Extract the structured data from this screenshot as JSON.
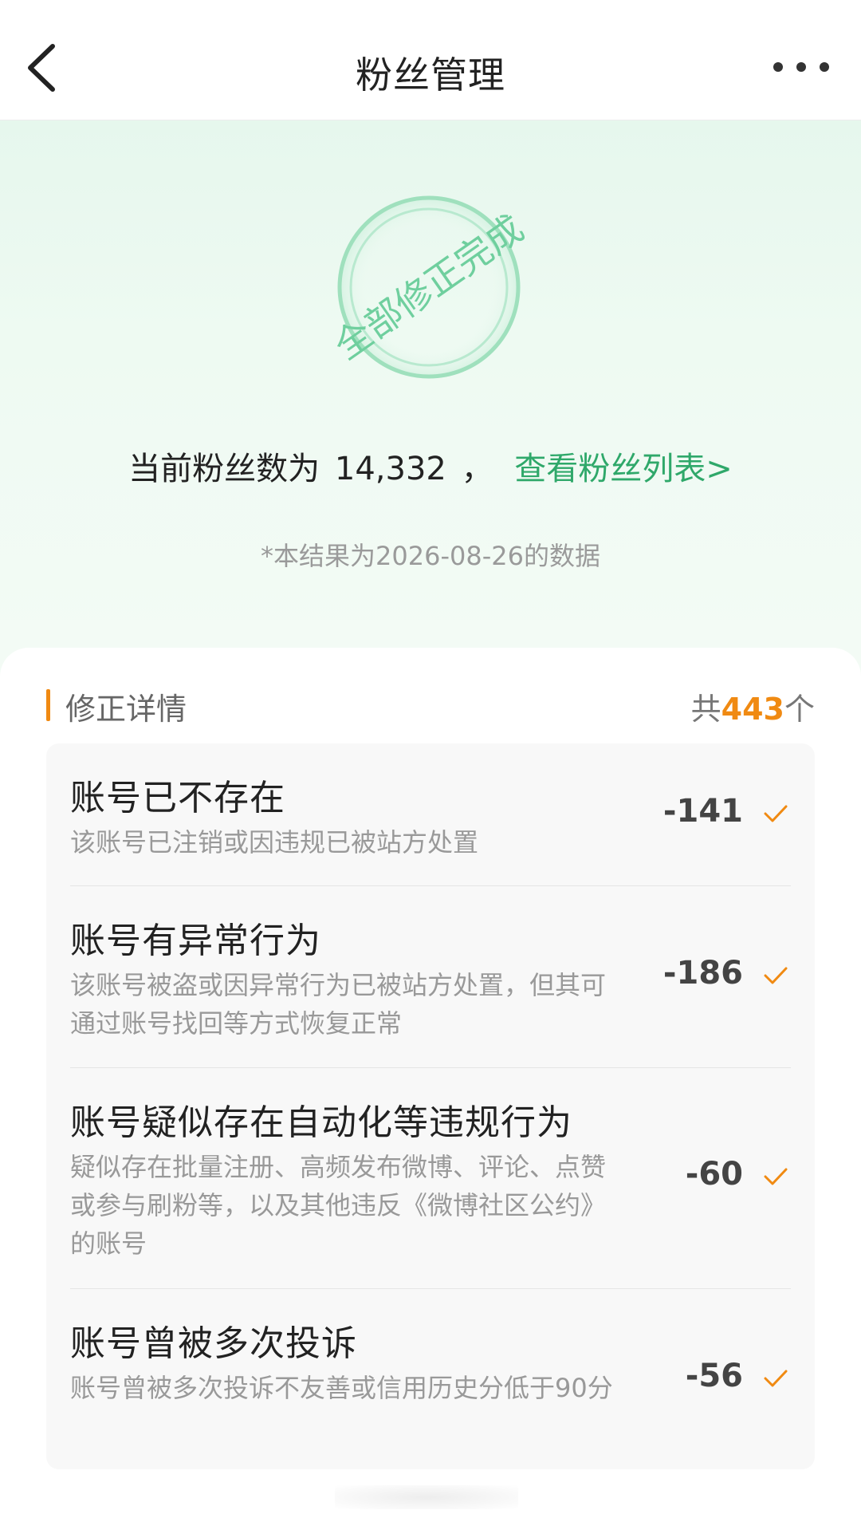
{
  "header": {
    "title": "粉丝管理",
    "back_icon": "chevron-left-icon",
    "more_icon": "more-horizontal-icon"
  },
  "stamp": {
    "text": "全部修正完成",
    "color": "#7fd3a8"
  },
  "summary": {
    "prefix": "当前粉丝数为",
    "count": "14,332",
    "separator": "，",
    "link": "查看粉丝列表>",
    "note": "*本结果为2026-08-26的数据"
  },
  "details": {
    "title": "修正详情",
    "total_prefix": "共",
    "total_count": "443",
    "total_suffix": "个",
    "items": [
      {
        "title": "账号已不存在",
        "desc": "该账号已注销或因违规已被站方处置",
        "value": "-141",
        "status_icon": "check-icon"
      },
      {
        "title": "账号有异常行为",
        "desc": "该账号被盗或因异常行为已被站方处置，但其可通过账号找回等方式恢复正常",
        "value": "-186",
        "status_icon": "check-icon"
      },
      {
        "title": "账号疑似存在自动化等违规行为",
        "desc": "疑似存在批量注册、高频发布微博、评论、点赞或参与刷粉等，以及其他违反《微博社区公约》的账号",
        "value": "-60",
        "status_icon": "check-icon"
      },
      {
        "title": "账号曾被多次投诉",
        "desc": "账号曾被多次投诉不友善或信用历史分低于90分",
        "value": "-56",
        "status_icon": "check-icon"
      }
    ]
  },
  "colors": {
    "accent_green": "#2fa86a",
    "accent_orange": "#f08a12"
  }
}
